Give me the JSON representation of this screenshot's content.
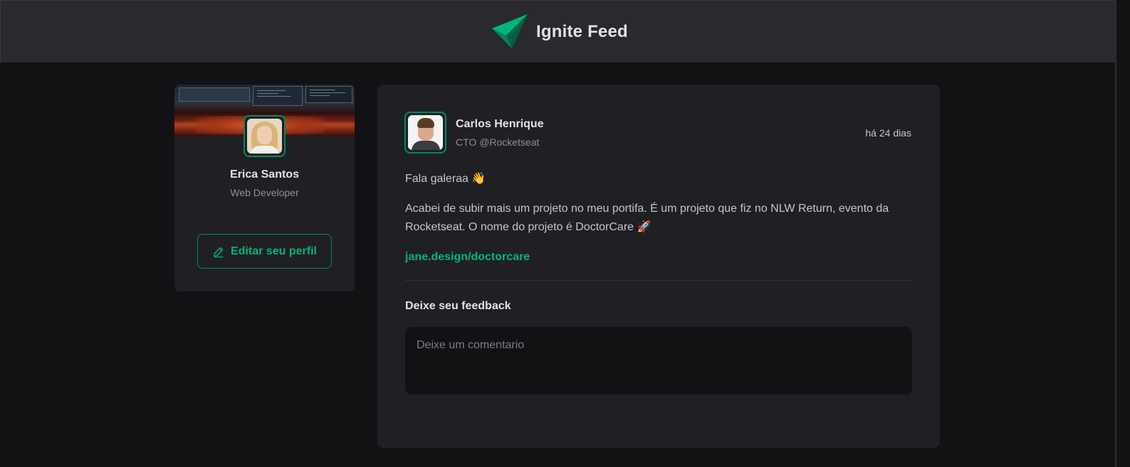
{
  "header": {
    "title": "Ignite Feed",
    "logo_icon": "ignite-logo-icon"
  },
  "sidebar": {
    "name": "Erica Santos",
    "role": "Web Developer",
    "edit_label": "Editar seu perfil",
    "edit_icon": "pencil-icon"
  },
  "post": {
    "author": {
      "name": "Carlos Henrique",
      "role": "CTO @Rocketseat"
    },
    "time": "há 24 dias",
    "paragraphs": [
      "Fala galeraa 👋",
      "Acabei de subir mais um projeto no meu portifa. É um projeto que fiz no NLW Return, evento da Rocketseat. O nome do projeto é DoctorCare 🚀"
    ],
    "link": "jane.design/doctorcare",
    "feedback_title": "Deixe seu feedback",
    "comment_placeholder": "Deixe um comentario"
  },
  "colors": {
    "accent": "#00875f",
    "accent_light": "#00b37e",
    "background": "#121214",
    "card": "#202024",
    "header": "#29292e"
  }
}
